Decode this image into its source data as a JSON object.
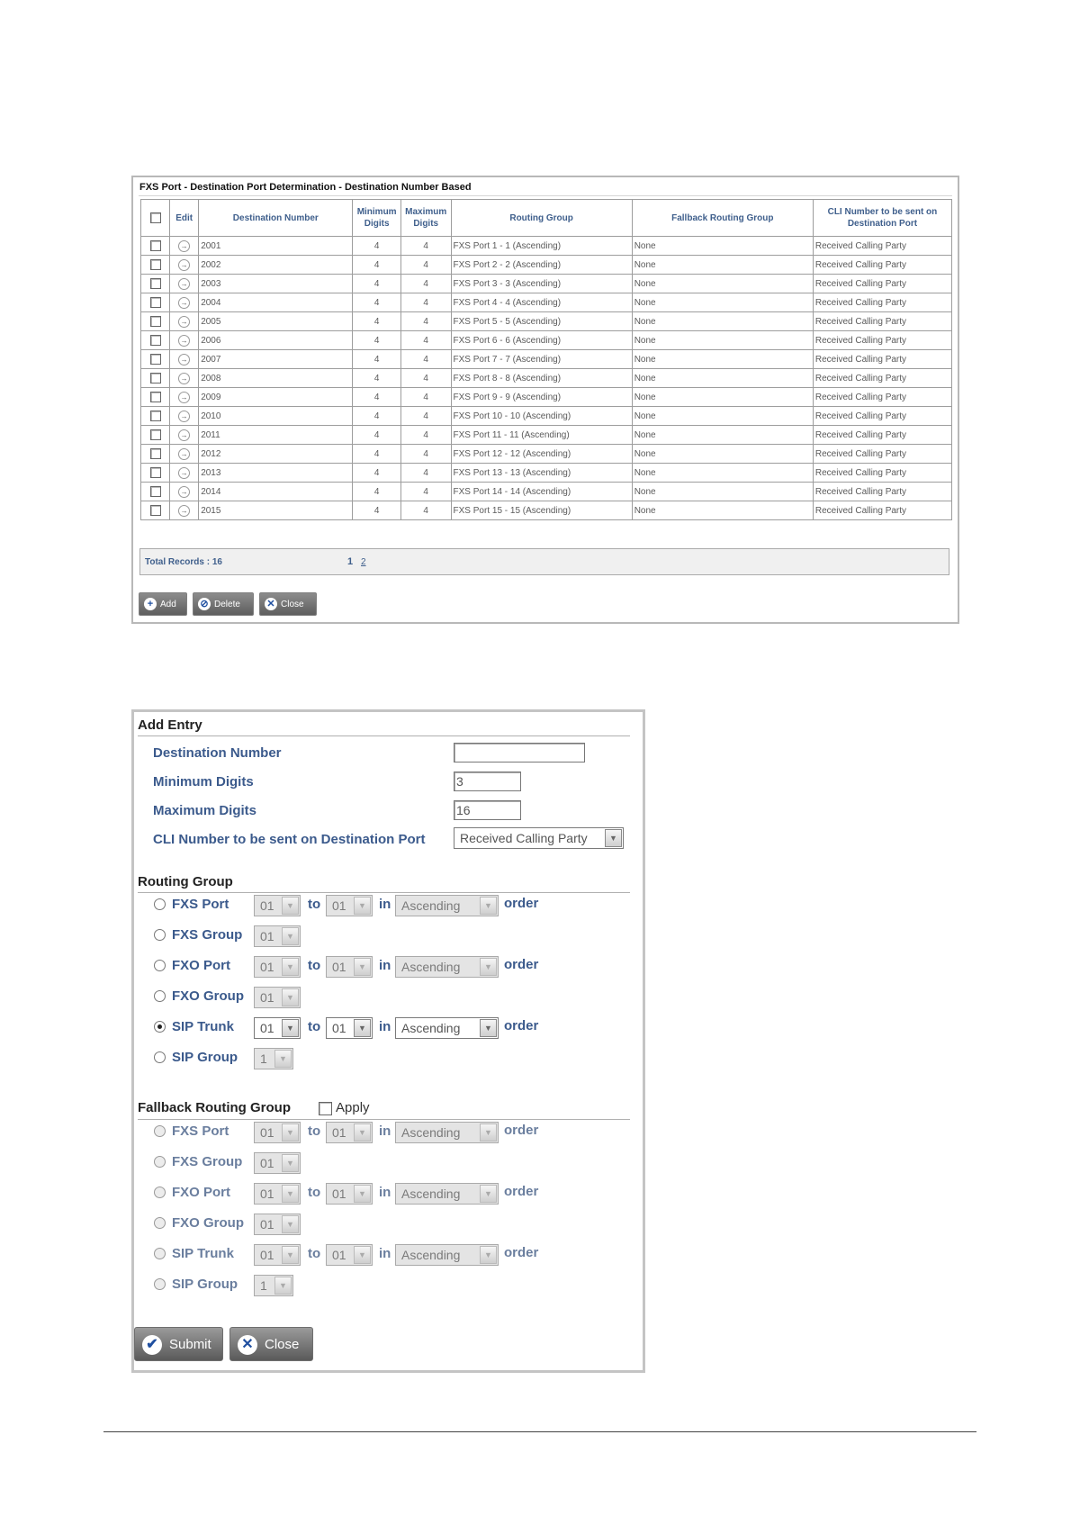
{
  "table_panel": {
    "title": "FXS Port - Destination Port Determination - Destination Number Based",
    "headers": {
      "edit": "Edit",
      "destination_number": "Destination Number",
      "minimum_digits_1": "Minimum",
      "minimum_digits_2": "Digits",
      "maximum_digits_1": "Maximum",
      "maximum_digits_2": "Digits",
      "routing_group": "Routing Group",
      "fallback_routing_group": "Fallback Routing Group",
      "cli_1": "CLI Number to be sent on",
      "cli_2": "Destination Port"
    },
    "rows": [
      {
        "dest": "2001",
        "min": "4",
        "max": "4",
        "routing": "FXS Port 1 - 1 (Ascending)",
        "fallback": "None",
        "cli": "Received Calling Party"
      },
      {
        "dest": "2002",
        "min": "4",
        "max": "4",
        "routing": "FXS Port 2 - 2 (Ascending)",
        "fallback": "None",
        "cli": "Received Calling Party"
      },
      {
        "dest": "2003",
        "min": "4",
        "max": "4",
        "routing": "FXS Port 3 - 3 (Ascending)",
        "fallback": "None",
        "cli": "Received Calling Party"
      },
      {
        "dest": "2004",
        "min": "4",
        "max": "4",
        "routing": "FXS Port 4 - 4 (Ascending)",
        "fallback": "None",
        "cli": "Received Calling Party"
      },
      {
        "dest": "2005",
        "min": "4",
        "max": "4",
        "routing": "FXS Port 5 - 5 (Ascending)",
        "fallback": "None",
        "cli": "Received Calling Party"
      },
      {
        "dest": "2006",
        "min": "4",
        "max": "4",
        "routing": "FXS Port 6 - 6 (Ascending)",
        "fallback": "None",
        "cli": "Received Calling Party"
      },
      {
        "dest": "2007",
        "min": "4",
        "max": "4",
        "routing": "FXS Port 7 - 7 (Ascending)",
        "fallback": "None",
        "cli": "Received Calling Party"
      },
      {
        "dest": "2008",
        "min": "4",
        "max": "4",
        "routing": "FXS Port 8 - 8 (Ascending)",
        "fallback": "None",
        "cli": "Received Calling Party"
      },
      {
        "dest": "2009",
        "min": "4",
        "max": "4",
        "routing": "FXS Port 9 - 9 (Ascending)",
        "fallback": "None",
        "cli": "Received Calling Party"
      },
      {
        "dest": "2010",
        "min": "4",
        "max": "4",
        "routing": "FXS Port 10 - 10 (Ascending)",
        "fallback": "None",
        "cli": "Received Calling Party"
      },
      {
        "dest": "2011",
        "min": "4",
        "max": "4",
        "routing": "FXS Port 11 - 11 (Ascending)",
        "fallback": "None",
        "cli": "Received Calling Party"
      },
      {
        "dest": "2012",
        "min": "4",
        "max": "4",
        "routing": "FXS Port 12 - 12 (Ascending)",
        "fallback": "None",
        "cli": "Received Calling Party"
      },
      {
        "dest": "2013",
        "min": "4",
        "max": "4",
        "routing": "FXS Port 13 - 13 (Ascending)",
        "fallback": "None",
        "cli": "Received Calling Party"
      },
      {
        "dest": "2014",
        "min": "4",
        "max": "4",
        "routing": "FXS Port 14 - 14 (Ascending)",
        "fallback": "None",
        "cli": "Received Calling Party"
      },
      {
        "dest": "2015",
        "min": "4",
        "max": "4",
        "routing": "FXS Port 15 - 15 (Ascending)",
        "fallback": "None",
        "cli": "Received Calling Party"
      }
    ],
    "total_records": "Total Records : 16",
    "pages": [
      "1",
      "2"
    ],
    "buttons": {
      "add": "Add",
      "delete": "Delete",
      "close": "Close"
    }
  },
  "add_entry": {
    "title": "Add Entry",
    "fields": {
      "destination_number_label": "Destination Number",
      "destination_number_value": "",
      "minimum_digits_label": "Minimum Digits",
      "minimum_digits_value": "3",
      "maximum_digits_label": "Maximum Digits",
      "maximum_digits_value": "16",
      "cli_label": "CLI Number to be sent on Destination Port",
      "cli_value": "Received Calling Party"
    },
    "routing_group": {
      "title": "Routing Group",
      "options": [
        {
          "label": "FXS Port",
          "from": "01",
          "to": "01",
          "order": "Ascending",
          "selected": false
        },
        {
          "label": "FXS Group",
          "from": "01",
          "selected": false
        },
        {
          "label": "FXO Port",
          "from": "01",
          "to": "01",
          "order": "Ascending",
          "selected": false
        },
        {
          "label": "FXO Group",
          "from": "01",
          "selected": false
        },
        {
          "label": "SIP Trunk",
          "from": "01",
          "to": "01",
          "order": "Ascending",
          "selected": true
        },
        {
          "label": "SIP Group",
          "from": "1",
          "selected": false
        }
      ]
    },
    "fallback_routing_group": {
      "title": "Fallback Routing Group",
      "apply_label": "Apply",
      "apply_checked": false,
      "options": [
        {
          "label": "FXS Port",
          "from": "01",
          "to": "01",
          "order": "Ascending"
        },
        {
          "label": "FXS Group",
          "from": "01"
        },
        {
          "label": "FXO Port",
          "from": "01",
          "to": "01",
          "order": "Ascending"
        },
        {
          "label": "FXO Group",
          "from": "01"
        },
        {
          "label": "SIP Trunk",
          "from": "01",
          "to": "01",
          "order": "Ascending"
        },
        {
          "label": "SIP Group",
          "from": "1"
        }
      ]
    },
    "words": {
      "to": "to",
      "in": "in",
      "order": "order"
    },
    "buttons": {
      "submit": "Submit",
      "close": "Close"
    }
  }
}
